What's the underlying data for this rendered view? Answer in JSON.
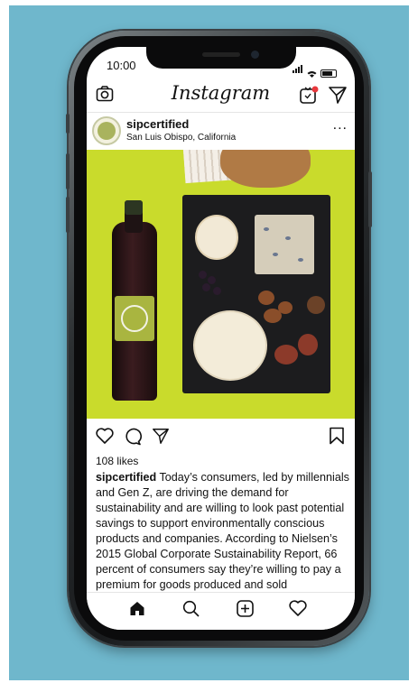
{
  "status": {
    "time": "10:00"
  },
  "app": {
    "name": "Instagram"
  },
  "post": {
    "username": "sipcertified",
    "location": "San Luis Obispo, California",
    "more": "...",
    "likes": "108 likes",
    "caption_user": "sipcertified",
    "caption_text": "Today’s consumers, led by millennials and Gen Z, are driving the demand for sustainability and are willing to look past potential savings to support environmentally conscious products and companies. According to Nielsen’s 2015 Global Corporate Sustainability Report, 66 percent of consumers say they’re willing to pay a premium for goods produced and sold"
  },
  "icons": {
    "header": [
      "camera-icon",
      "igtv-icon",
      "direct-message-icon"
    ],
    "actions": [
      "heart-icon",
      "comment-icon",
      "share-icon",
      "bookmark-icon"
    ],
    "tabs": [
      "home-icon",
      "search-icon",
      "add-post-icon",
      "activity-heart-icon"
    ]
  },
  "colors": {
    "background": "#6fb7cc",
    "photo_bg": "#c9db2c",
    "notification_dot": "#e8383d"
  }
}
